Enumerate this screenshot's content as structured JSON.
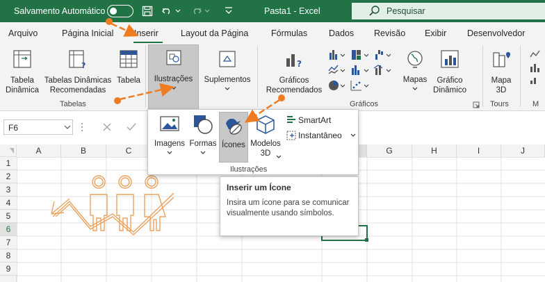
{
  "titlebar": {
    "autosave_label": "Salvamento Automático",
    "doc_title": "Pasta1  -  Excel",
    "search_placeholder": "Pesquisar"
  },
  "tabs": [
    {
      "label": "Arquivo"
    },
    {
      "label": "Página Inicial"
    },
    {
      "label": "Inserir",
      "active": true
    },
    {
      "label": "Layout da Página"
    },
    {
      "label": "Fórmulas"
    },
    {
      "label": "Dados"
    },
    {
      "label": "Revisão"
    },
    {
      "label": "Exibir"
    },
    {
      "label": "Desenvolvedor"
    }
  ],
  "ribbon": {
    "tabela_dinamica": "Tabela\nDinâmica",
    "tabelas_dinamicas_rec": "Tabelas Dinâmicas\nRecomendadas",
    "tabela": "Tabela",
    "ilustracoes": "Ilustrações",
    "suplementos": "Suplementos",
    "graficos_rec": "Gráficos\nRecomendados",
    "mapas": "Mapas",
    "grafico_dinamico": "Gráfico\nDinâmico",
    "mapa_3d": "Mapa\n3D",
    "groups": {
      "tabelas": "Tabelas",
      "graficos": "Gráficos",
      "tours": "Tours",
      "m": "M"
    }
  },
  "formula_bar": {
    "name_box": "F6"
  },
  "grid": {
    "columns": [
      "A",
      "B",
      "C",
      "D",
      "E",
      "F",
      "G",
      "H",
      "I",
      "J"
    ],
    "rows": [
      "1",
      "2",
      "3",
      "4",
      "5",
      "6",
      "7",
      "8",
      "9"
    ],
    "selected_cell": "F6"
  },
  "dropdown": {
    "imagens": "Imagens",
    "formas": "Formas",
    "icones": "Ícones",
    "modelos_3d": "Modelos\n3D",
    "smartart": "SmartArt",
    "instantaneo": "Instantâneo",
    "group_label": "Ilustrações"
  },
  "tooltip": {
    "title": "Inserir um Ícone",
    "body": "Insira um ícone para se comunicar visualmente usando símbolos."
  },
  "colors": {
    "excel_green": "#217346",
    "annotation_orange": "#f07c22"
  }
}
